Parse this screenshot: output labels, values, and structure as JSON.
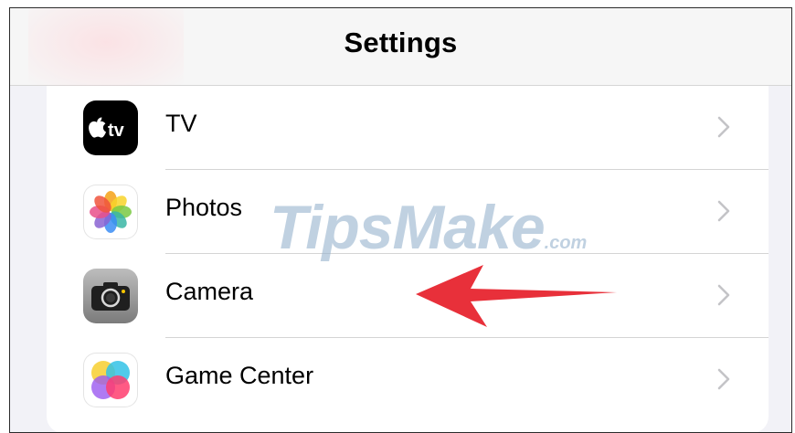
{
  "nav": {
    "title": "Settings"
  },
  "rows": [
    {
      "label": "TV",
      "icon": "apple-tv-icon"
    },
    {
      "label": "Photos",
      "icon": "photos-icon"
    },
    {
      "label": "Camera",
      "icon": "camera-icon"
    },
    {
      "label": "Game Center",
      "icon": "game-center-icon"
    }
  ],
  "watermark": {
    "brand": "TipsMake",
    "suffix": ".com"
  },
  "colors": {
    "arrow": "#e8303a",
    "chevron": "#c4c4c7",
    "group_bg": "#f2f2f7"
  }
}
